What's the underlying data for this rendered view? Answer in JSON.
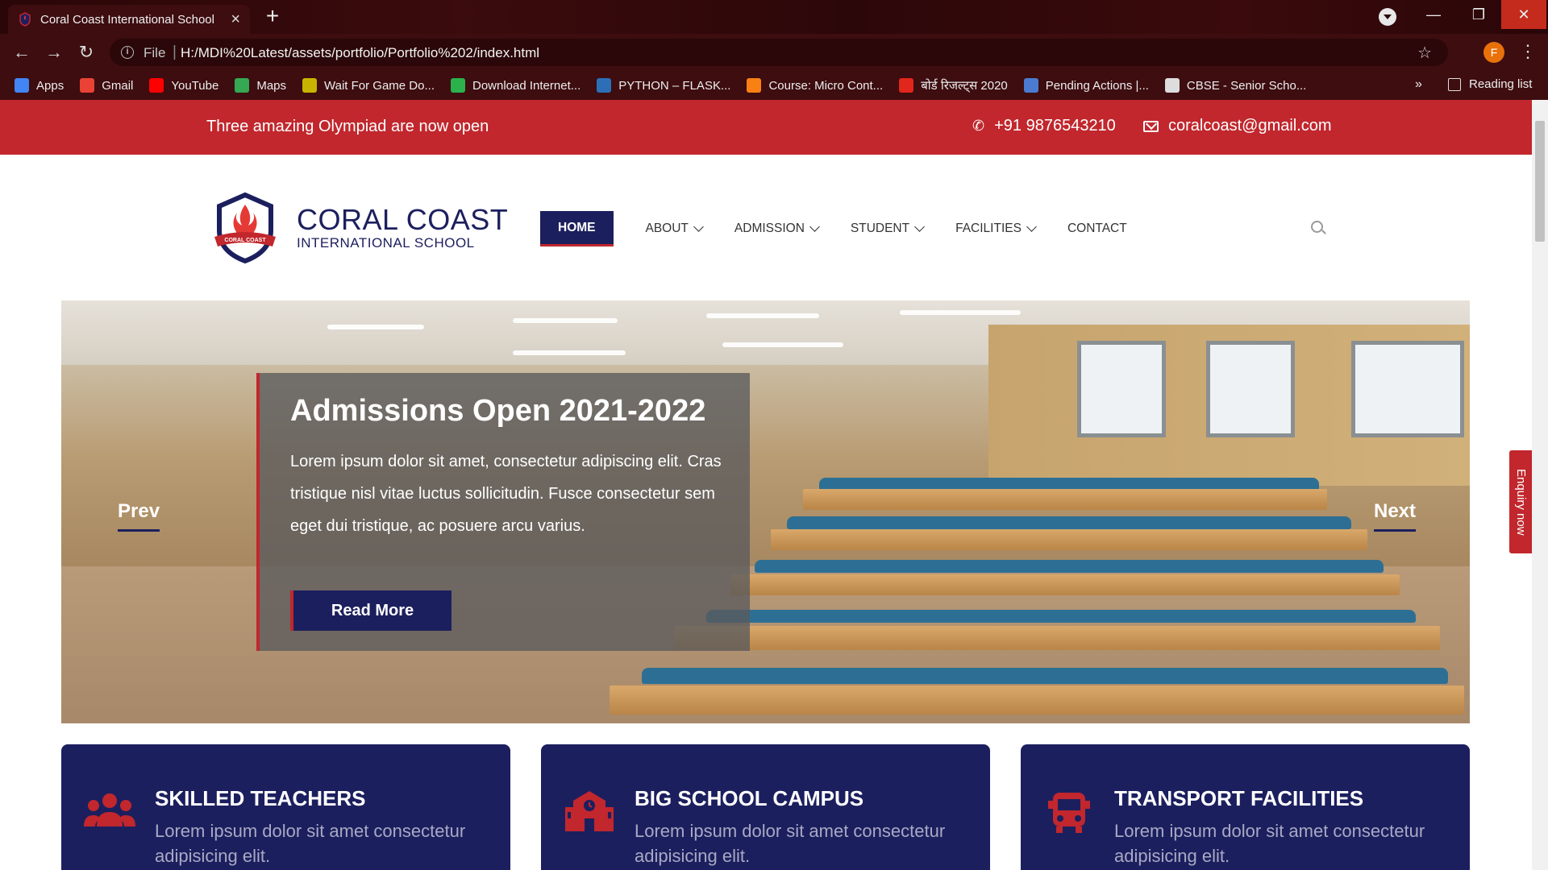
{
  "browser": {
    "tab_title": "Coral Coast International School",
    "url_scheme": "File",
    "url": "H:/MDI%20Latest/assets/portfolio/Portfolio%202/index.html",
    "profile_initial": "F",
    "bookmarks": [
      {
        "label": "Apps",
        "icon": "apps-grid-icon",
        "color": "#4285f4"
      },
      {
        "label": "Gmail",
        "icon": "gmail-icon",
        "color": "#ea4335"
      },
      {
        "label": "YouTube",
        "icon": "youtube-icon",
        "color": "#ff0000"
      },
      {
        "label": "Maps",
        "icon": "maps-pin-icon",
        "color": "#34a853"
      },
      {
        "label": "Wait For Game Do...",
        "icon": "ipc-games-icon",
        "color": "#c8b400"
      },
      {
        "label": "Download Internet...",
        "icon": "green-flag-icon",
        "color": "#2bb24c"
      },
      {
        "label": "PYTHON – FLASK...",
        "icon": "flask-icon",
        "color": "#2c6fb7"
      },
      {
        "label": "Course: Micro Cont...",
        "icon": "moodle-icon",
        "color": "#f98012"
      },
      {
        "label": "बोर्ड रिजल्ट्स 2020",
        "icon": "news18-icon",
        "color": "#e1261c"
      },
      {
        "label": "Pending Actions |...",
        "icon": "c-logo-icon",
        "color": "#4a7bd0"
      },
      {
        "label": "CBSE - Senior Scho...",
        "icon": "globe-icon",
        "color": "#dddddd"
      }
    ],
    "more": "»",
    "reading_list": "Reading list"
  },
  "topbar": {
    "message": "Three amazing Olympiad are now open",
    "phone": "+91 9876543210",
    "email": "coralcoast@gmail.com"
  },
  "logo": {
    "name": "CORAL COAST",
    "subtitle": "INTERNATIONAL SCHOOL",
    "crest_text": "CORAL COAST"
  },
  "nav": [
    {
      "label": "HOME",
      "active": true,
      "dropdown": false
    },
    {
      "label": "ABOUT",
      "active": false,
      "dropdown": true
    },
    {
      "label": "ADMISSION",
      "active": false,
      "dropdown": true
    },
    {
      "label": "STUDENT",
      "active": false,
      "dropdown": true
    },
    {
      "label": "FACILITIES",
      "active": false,
      "dropdown": true
    },
    {
      "label": "CONTACT",
      "active": false,
      "dropdown": false
    }
  ],
  "hero": {
    "title": "Admissions Open 2021-2022",
    "text": "Lorem ipsum dolor sit amet, consectetur adipiscing elit. Cras tristique nisl vitae luctus sollicitudin. Fusce consectetur sem eget dui tristique, ac posuere arcu varius.",
    "button": "Read More",
    "prev": "Prev",
    "next": "Next"
  },
  "enquiry": "Enquiry now",
  "features": [
    {
      "title": "SKILLED TEACHERS",
      "text": "Lorem ipsum dolor sit amet consectetur adipisicing elit.",
      "icon": "users-group-icon"
    },
    {
      "title": "BIG SCHOOL CAMPUS",
      "text": "Lorem ipsum dolor sit amet consectetur adipisicing elit.",
      "icon": "school-building-icon"
    },
    {
      "title": "TRANSPORT FACILITIES",
      "text": "Lorem ipsum dolor sit amet consectetur adipisicing elit.",
      "icon": "bus-icon"
    }
  ],
  "colors": {
    "brand_red": "#c1272d",
    "brand_navy": "#1c1f5e",
    "chrome_bg": "#3d0d10"
  }
}
